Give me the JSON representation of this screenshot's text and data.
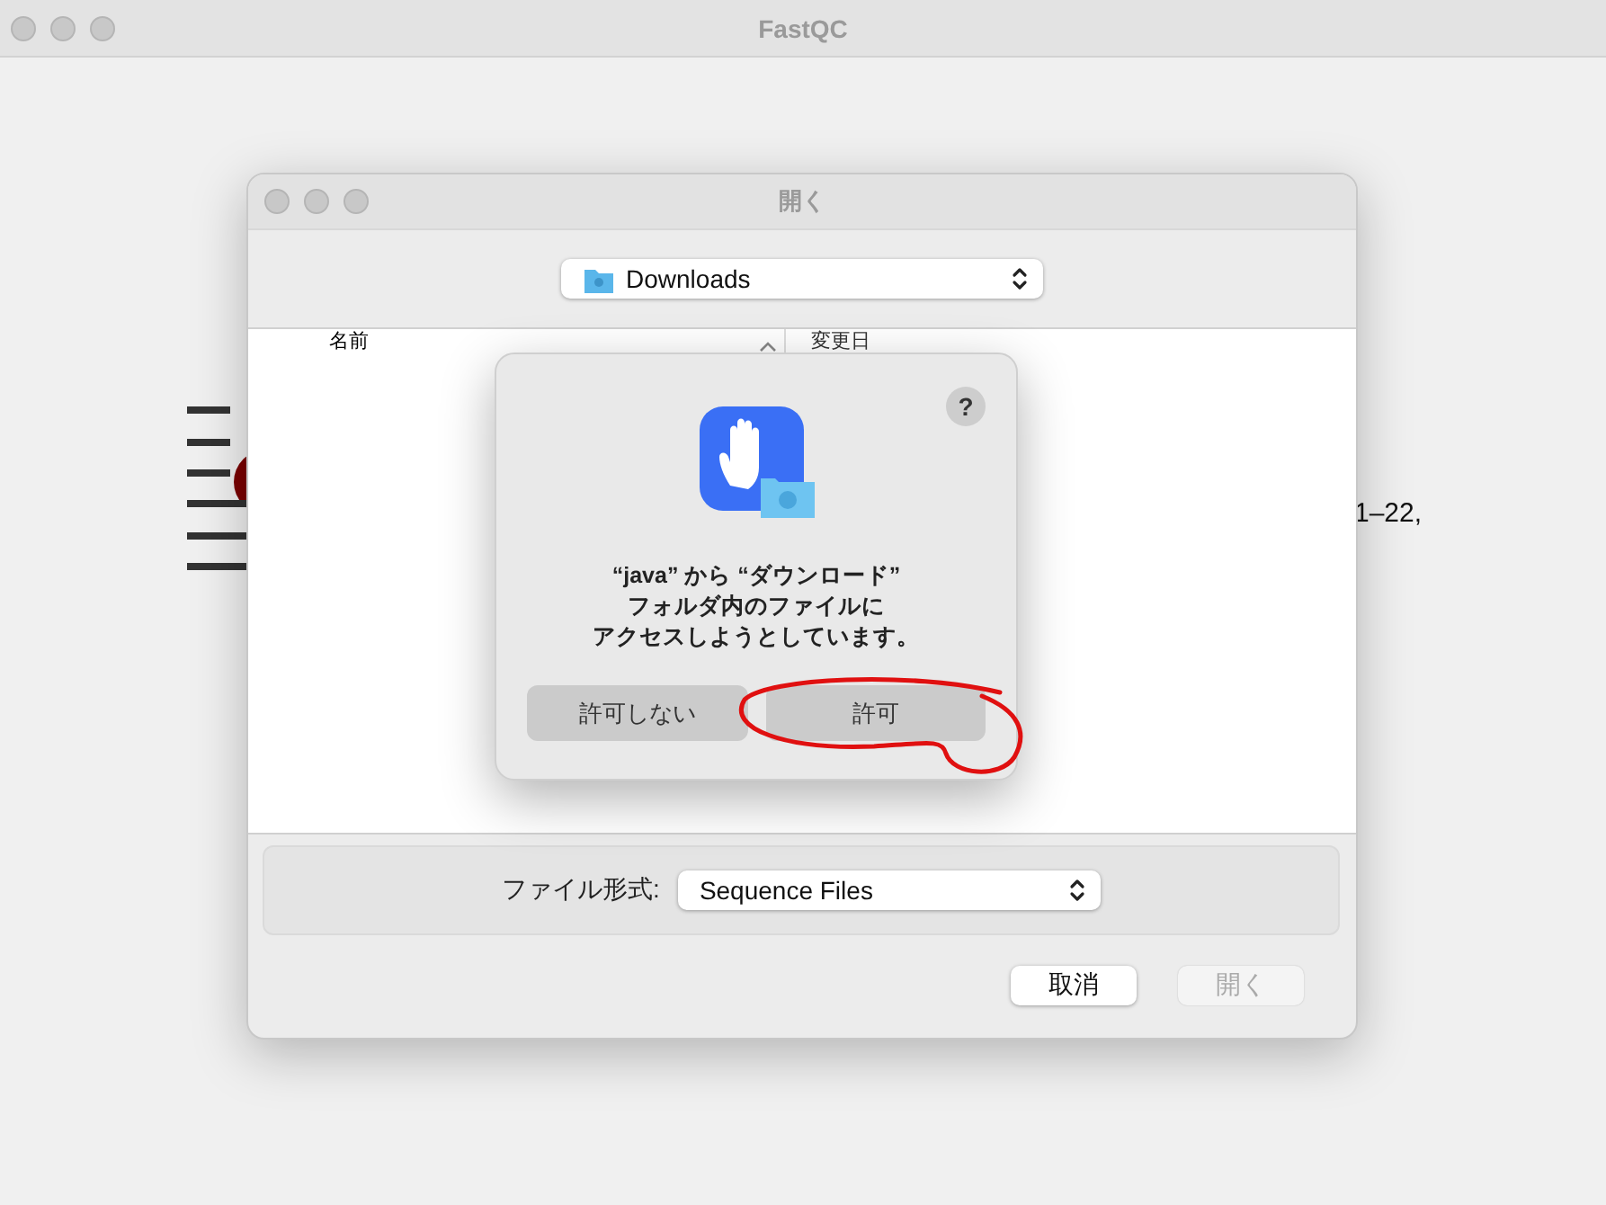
{
  "window": {
    "title": "FastQC"
  },
  "background_text": "1–22,",
  "open_dialog": {
    "title": "開く",
    "location": "Downloads",
    "columns": [
      {
        "label": "名前",
        "sorted": true
      },
      {
        "label": "変更日",
        "sorted": false
      }
    ],
    "file_format": {
      "label": "ファイル形式:",
      "value": "Sequence Files"
    },
    "buttons": [
      {
        "label": "取消",
        "disabled": false
      },
      {
        "label": "開く",
        "disabled": true
      }
    ]
  },
  "alert": {
    "help": "?",
    "message_lines": [
      "“java” から “ダウンロード”",
      "フォルダ内のファイルに",
      "アクセスしようとしています。"
    ],
    "buttons": [
      {
        "label": "許可しない"
      },
      {
        "label": "許可"
      }
    ]
  }
}
